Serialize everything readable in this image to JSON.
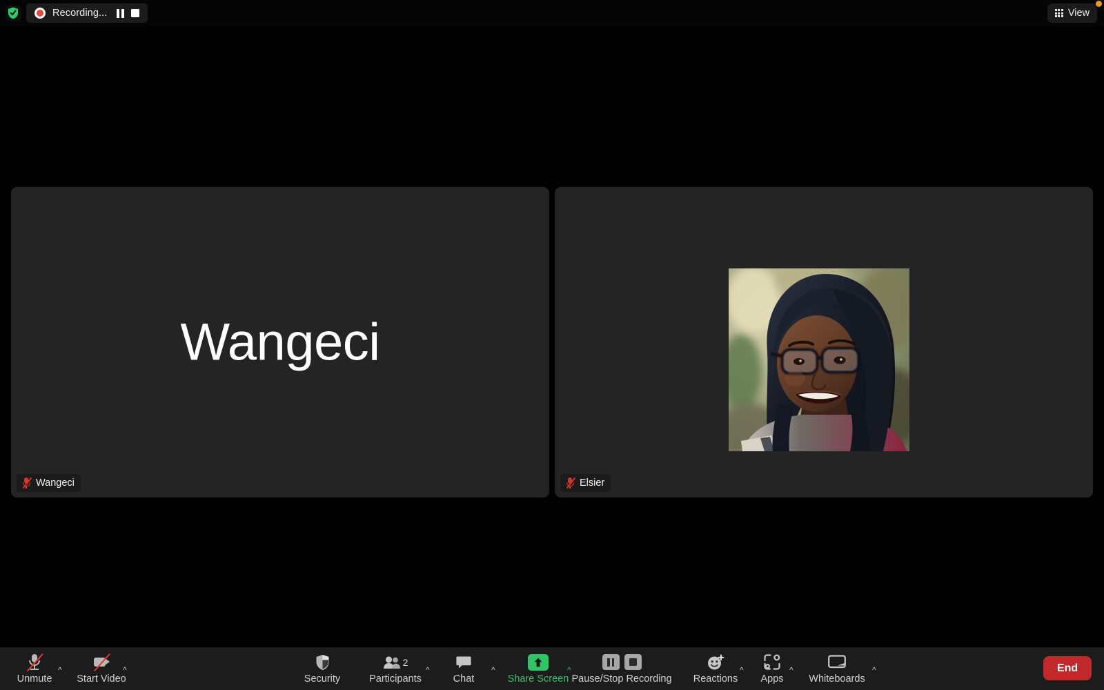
{
  "topbar": {
    "security_badge_icon": "shield-check-icon",
    "recording": {
      "label": "Recording...",
      "record_dot_icon": "record-dot-icon",
      "pause_icon": "pause-icon",
      "stop_icon": "stop-icon"
    },
    "view": {
      "label": "View",
      "icon": "grid-view-icon",
      "notification_dot_color": "#e79b1e"
    }
  },
  "stage": {
    "tiles": [
      {
        "display_name": "Wangeci",
        "name_tag": "Wangeci",
        "mic_icon": "mic-muted-icon",
        "has_video": false
      },
      {
        "display_name": "Elsier",
        "name_tag": "Elsier",
        "mic_icon": "mic-muted-icon",
        "has_video": true
      }
    ]
  },
  "toolbar": {
    "items": [
      {
        "id": "unmute",
        "label": "Unmute",
        "icon": "mic-muted-icon",
        "caret": true
      },
      {
        "id": "start-video",
        "label": "Start Video",
        "icon": "video-off-icon",
        "caret": true
      },
      {
        "id": "security",
        "label": "Security",
        "icon": "shield-icon",
        "caret": false
      },
      {
        "id": "participants",
        "label": "Participants",
        "icon": "people-icon",
        "caret": true,
        "count": "2"
      },
      {
        "id": "chat",
        "label": "Chat",
        "icon": "chat-bubble-icon",
        "caret": true
      },
      {
        "id": "share-screen",
        "label": "Share Screen",
        "icon": "share-screen-icon",
        "caret": true
      },
      {
        "id": "recording",
        "label": "Pause/Stop Recording",
        "icon": "pause-stop-icon",
        "caret": false
      },
      {
        "id": "reactions",
        "label": "Reactions",
        "icon": "reactions-icon",
        "caret": true
      },
      {
        "id": "apps",
        "label": "Apps",
        "icon": "apps-icon",
        "caret": true
      },
      {
        "id": "whiteboards",
        "label": "Whiteboards",
        "icon": "whiteboard-icon",
        "caret": true
      }
    ],
    "end_button": {
      "label": "End",
      "color": "#c0282a"
    },
    "highlight": {
      "target": "Pause/Stop Recording",
      "color": "#1f9bf0"
    }
  }
}
